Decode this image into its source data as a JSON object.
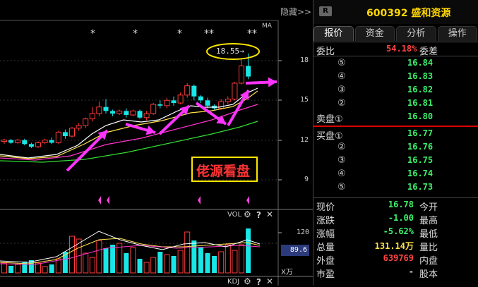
{
  "toolbar": {
    "hide_label": "隐藏>>"
  },
  "chart_header": {
    "ma_label": "MA"
  },
  "chart": {
    "price_axis": [
      "18",
      "15",
      "12",
      "9"
    ],
    "high_label": "18.55→",
    "watermark": "佬源看盘",
    "star_labels": [
      "*",
      "*",
      "*",
      "**",
      "**"
    ]
  },
  "volume": {
    "title": "VOL",
    "axis_top": "120",
    "current": "89.6",
    "unit": "X万",
    "gear": "⚙",
    "help": "?",
    "close": "✕"
  },
  "kdj": {
    "title": "KDJ",
    "gear": "⚙",
    "help": "?",
    "close": "✕"
  },
  "stock": {
    "badge": "R",
    "code": "600392",
    "name": "盛和资源"
  },
  "tabs": [
    {
      "label": "报价"
    },
    {
      "label": "资金"
    },
    {
      "label": "分析"
    },
    {
      "label": "操作"
    }
  ],
  "order_ratio": {
    "label": "委比",
    "value": "54.18%",
    "label2": "委差"
  },
  "asks": [
    {
      "mark": "⑤",
      "price": "16.84"
    },
    {
      "mark": "④",
      "price": "16.83"
    },
    {
      "mark": "③",
      "price": "16.82"
    },
    {
      "mark": "②",
      "price": "16.81"
    },
    {
      "mark": "卖盘①",
      "price": "16.80"
    }
  ],
  "bids": [
    {
      "mark": "买盘①",
      "price": "16.77"
    },
    {
      "mark": "②",
      "price": "16.76"
    },
    {
      "mark": "③",
      "price": "16.75"
    },
    {
      "mark": "④",
      "price": "16.74"
    },
    {
      "mark": "⑤",
      "price": "16.73"
    }
  ],
  "quote": [
    {
      "label": "现价",
      "value": "16.78",
      "color": "#3df26a",
      "label2": "今开"
    },
    {
      "label": "涨跌",
      "value": "-1.00",
      "color": "#3df26a",
      "label2": "最高"
    },
    {
      "label": "涨幅",
      "value": "-5.62%",
      "color": "#3df26a",
      "label2": "最低"
    },
    {
      "label": "总量",
      "value": "131.14万",
      "color": "#ffe14d",
      "label2": "量比"
    },
    {
      "label": "外盘",
      "value": "639769",
      "color": "#ff4444",
      "label2": "内盘"
    },
    {
      "label": "市盈",
      "value": "-",
      "color": "#dddddd",
      "label2": "股本"
    }
  ]
}
